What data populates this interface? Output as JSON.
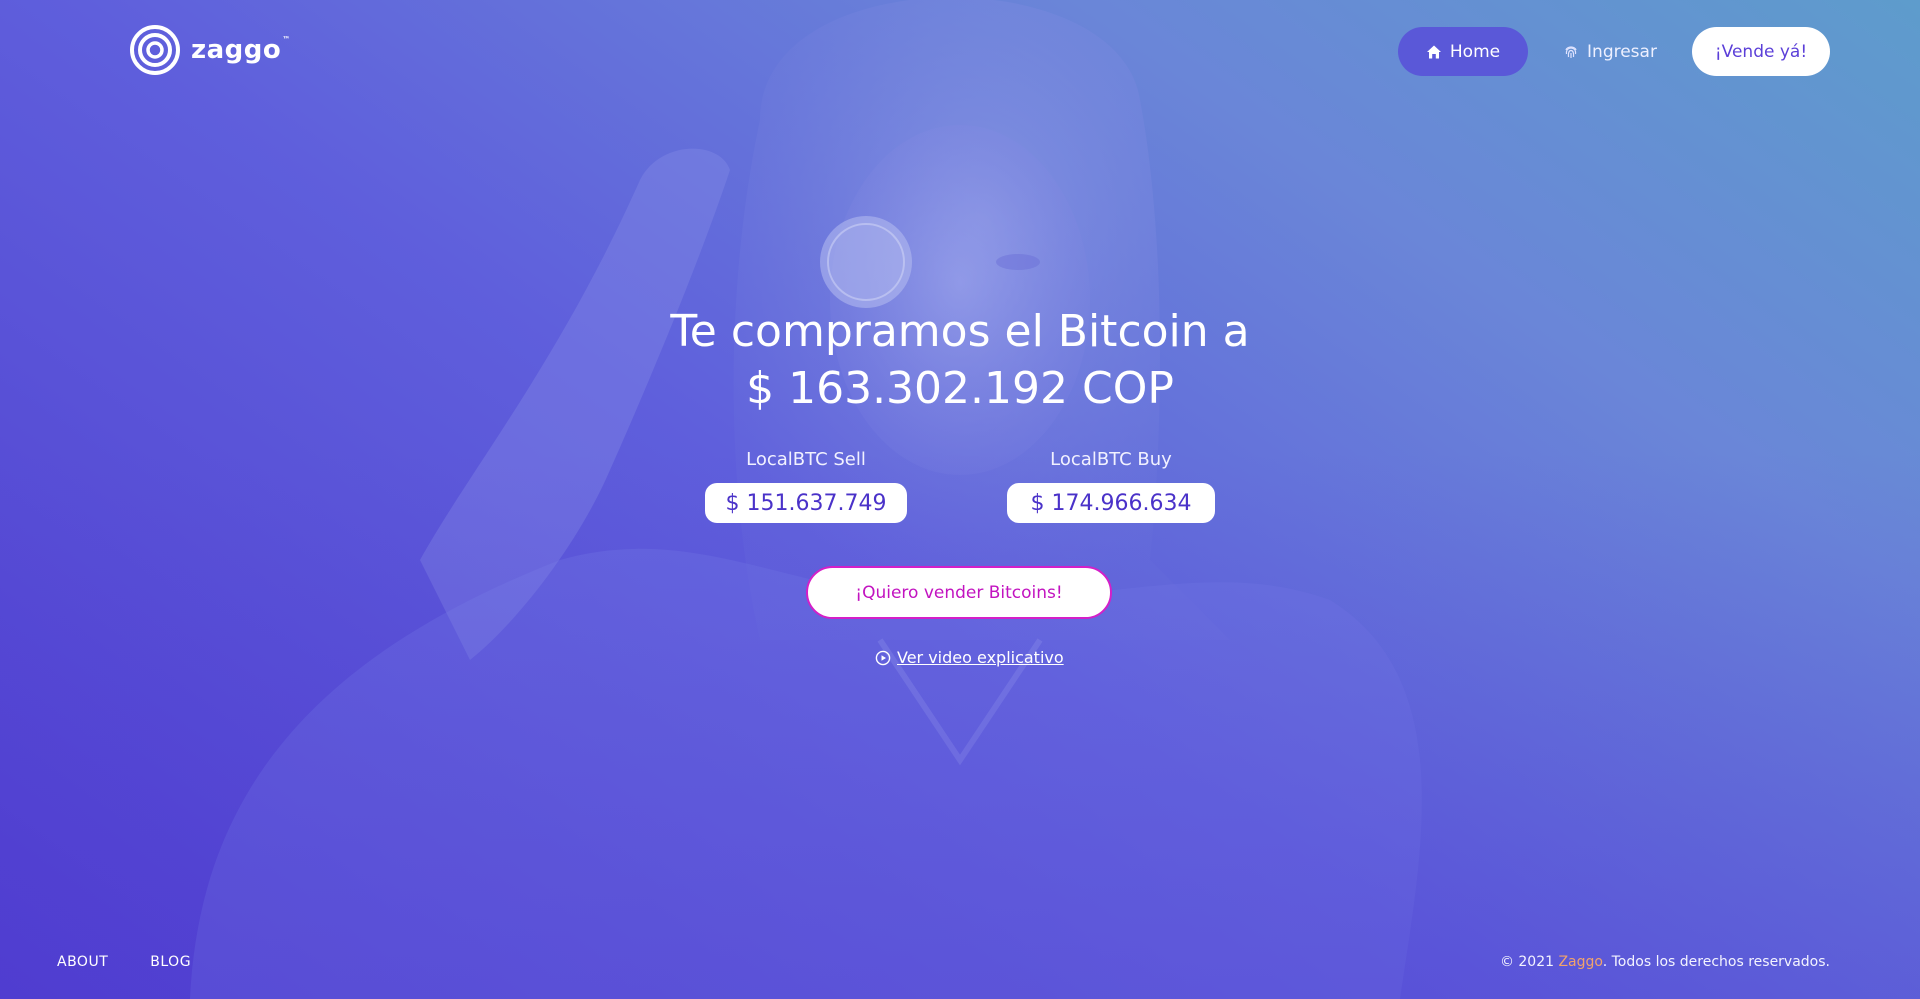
{
  "brand": {
    "logo_text": "zaggo",
    "logo_tm": "™",
    "accent_color": "#5b3fd8",
    "cta_color": "#d41fc8",
    "brand_link_color": "#f2a36b"
  },
  "nav": {
    "home_label": "Home",
    "home_icon": "home-icon",
    "login_label": "Ingresar",
    "login_icon": "fingerprint-icon",
    "sell_label": "¡Vende yá!"
  },
  "hero": {
    "title_line1": "Te compramos el Bitcoin a",
    "title_line2": "$ 163.302.192 COP",
    "sell": {
      "label": "LocalBTC Sell",
      "value": "$ 151.637.749"
    },
    "buy": {
      "label": "LocalBTC Buy",
      "value": "$ 174.966.634"
    },
    "cta_label": "¡Quiero vender Bitcoins!",
    "video_label": "Ver video explicativo",
    "video_icon": "play-circle-icon"
  },
  "footer": {
    "links": [
      "ABOUT",
      "BLOG"
    ],
    "copyright_prefix": "© 2021 ",
    "copyright_brand": "Zaggo",
    "copyright_suffix": ". Todos los derechos reservados."
  }
}
